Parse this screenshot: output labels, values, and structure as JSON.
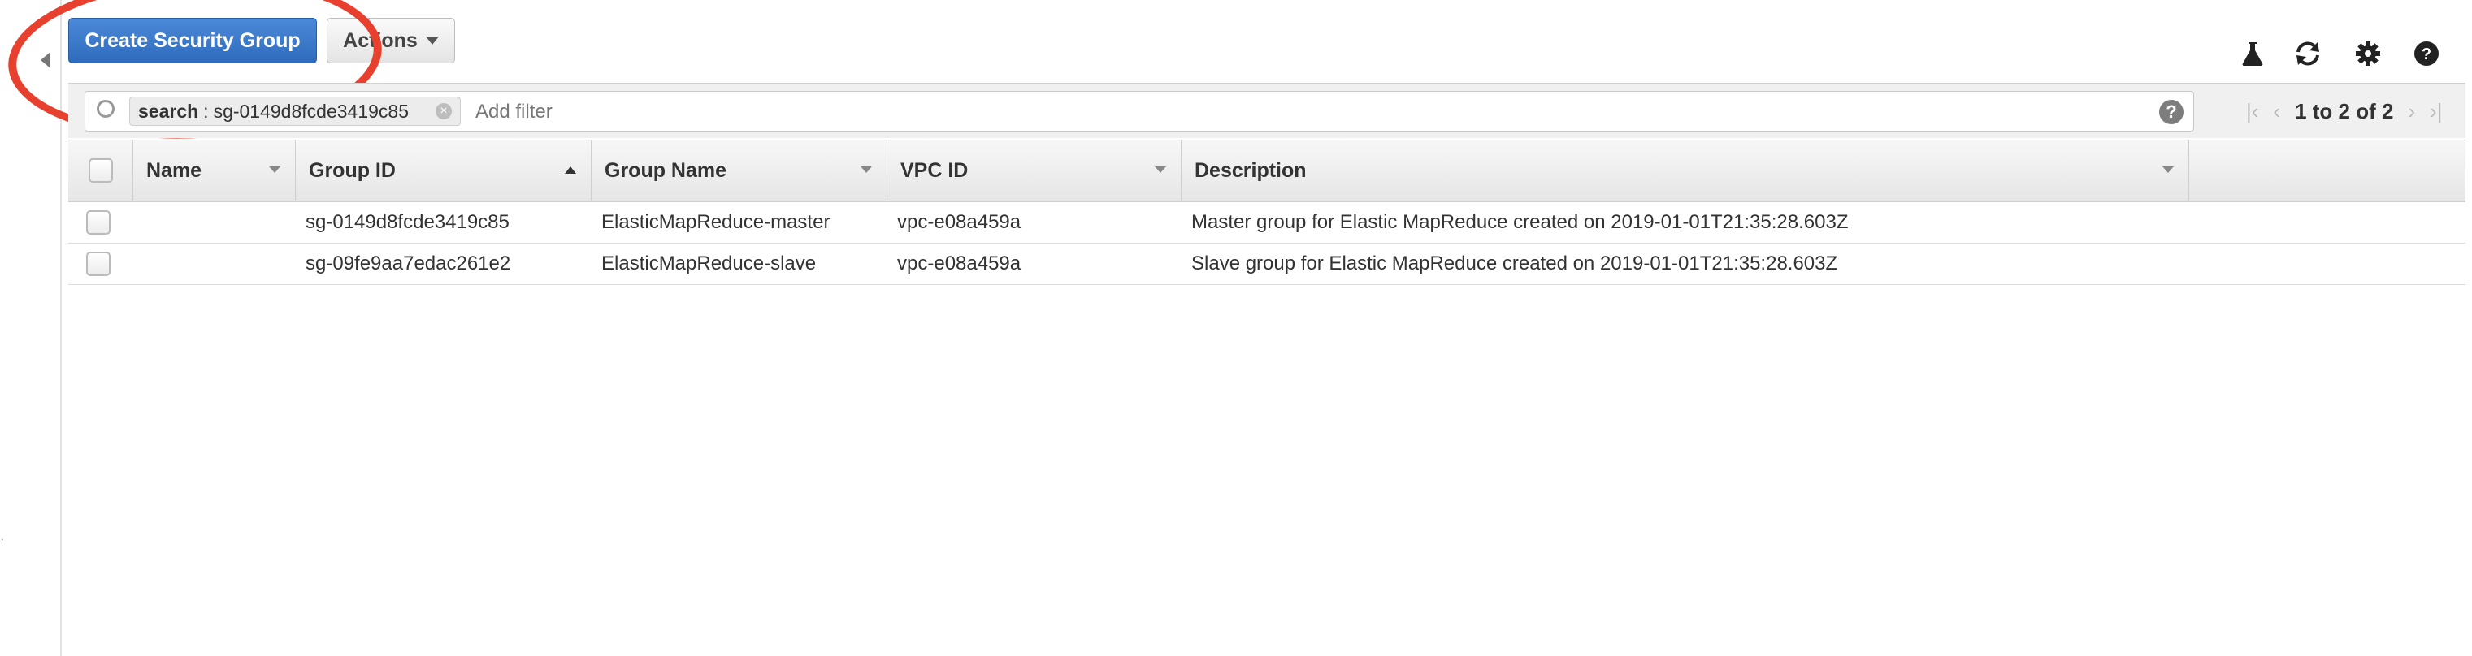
{
  "toolbar": {
    "create_label": "Create Security Group",
    "actions_label": "Actions"
  },
  "icons": {
    "lab": "flask-icon",
    "refresh": "refresh-icon",
    "settings": "gear-icon",
    "help": "help-icon"
  },
  "filter": {
    "token_key": "search",
    "token_value": "sg-0149d8fcde3419c85",
    "placeholder": "Add filter"
  },
  "pager": {
    "text": "1 to 2 of 2"
  },
  "table": {
    "columns": [
      "Name",
      "Group ID",
      "Group Name",
      "VPC ID",
      "Description"
    ],
    "rows": [
      {
        "name": "",
        "group_id": "sg-0149d8fcde3419c85",
        "group_name": "ElasticMapReduce-master",
        "vpc_id": "vpc-e08a459a",
        "description": "Master group for Elastic MapReduce created on 2019-01-01T21:35:28.603Z"
      },
      {
        "name": "",
        "group_id": "sg-09fe9aa7edac261e2",
        "group_name": "ElasticMapReduce-slave",
        "vpc_id": "vpc-e08a459a",
        "description": "Slave group for Elastic MapReduce created on 2019-01-01T21:35:28.603Z"
      }
    ]
  },
  "colors": {
    "primary_button": "#2f6bbd",
    "annotation_circle": "#e8402e"
  }
}
